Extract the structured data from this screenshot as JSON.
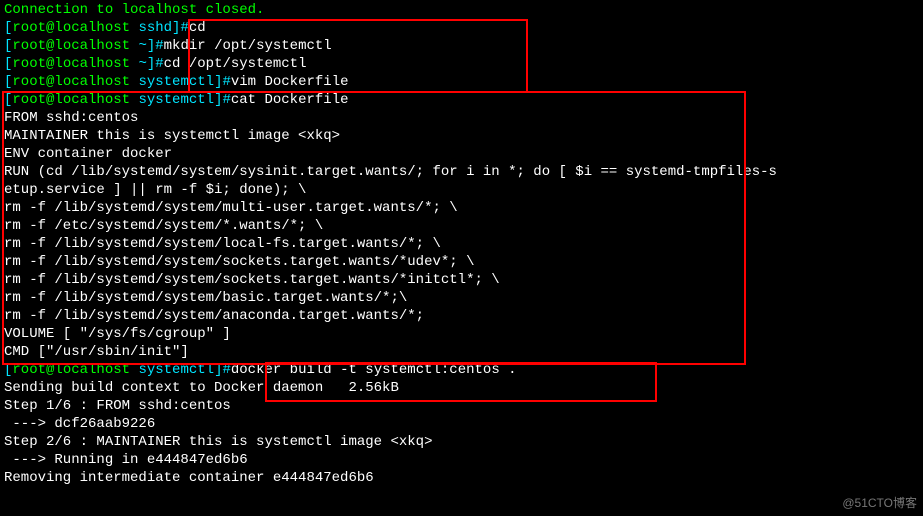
{
  "connection_closed": "Connection to localhost closed.",
  "p1": {
    "open": "[",
    "user": "root@localhost ",
    "dir": "sshd",
    "close": "]#",
    "cmd": "cd"
  },
  "p2": {
    "open": "[",
    "user": "root@localhost ",
    "dir": "~",
    "close": "]#",
    "cmd": "mkdir /opt/systemctl"
  },
  "p3": {
    "open": "[",
    "user": "root@localhost ",
    "dir": "~",
    "close": "]#",
    "cmd": "cd /opt/systemctl"
  },
  "p4": {
    "open": "[",
    "user": "root@localhost ",
    "dir": "systemctl",
    "close": "]#",
    "cmd": "vim Dockerfile"
  },
  "p5": {
    "open": "[",
    "user": "root@localhost ",
    "dir": "systemctl",
    "close": "]#",
    "cmd": "cat Dockerfile"
  },
  "dockerfile": {
    "l1": "FROM sshd:centos",
    "l2": "MAINTAINER this is systemctl image <xkq>",
    "l3": "ENV container docker",
    "l4": "RUN (cd /lib/systemd/system/sysinit.target.wants/; for i in *; do [ $i == systemd-tmpfiles-s",
    "l5": "etup.service ] || rm -f $i; done); \\",
    "l6": "rm -f /lib/systemd/system/multi-user.target.wants/*; \\",
    "l7": "rm -f /etc/systemd/system/*.wants/*; \\",
    "l8": "rm -f /lib/systemd/system/local-fs.target.wants/*; \\",
    "l9": "rm -f /lib/systemd/system/sockets.target.wants/*udev*; \\",
    "l10": "rm -f /lib/systemd/system/sockets.target.wants/*initctl*; \\",
    "l11": "rm -f /lib/systemd/system/basic.target.wants/*;\\",
    "l12": "rm -f /lib/systemd/system/anaconda.target.wants/*;",
    "l13": "VOLUME [ \"/sys/fs/cgroup\" ]",
    "l14": "CMD [\"/usr/sbin/init\"]"
  },
  "p6": {
    "open": "[",
    "user": "root@localhost ",
    "dir": "systemctl",
    "close": "]#",
    "cmd": "docker build -t systemctl:centos ."
  },
  "build": {
    "l1": "Sending build context to Docker daemon   2.56kB",
    "l2": "Step 1/6 : FROM sshd:centos",
    "l3": " ---> dcf26aab9226",
    "l4": "Step 2/6 : MAINTAINER this is systemctl image <xkq>",
    "l5": " ---> Running in e444847ed6b6",
    "l6": "Removing intermediate container e444847ed6b6"
  },
  "watermark": "@51CTO博客"
}
